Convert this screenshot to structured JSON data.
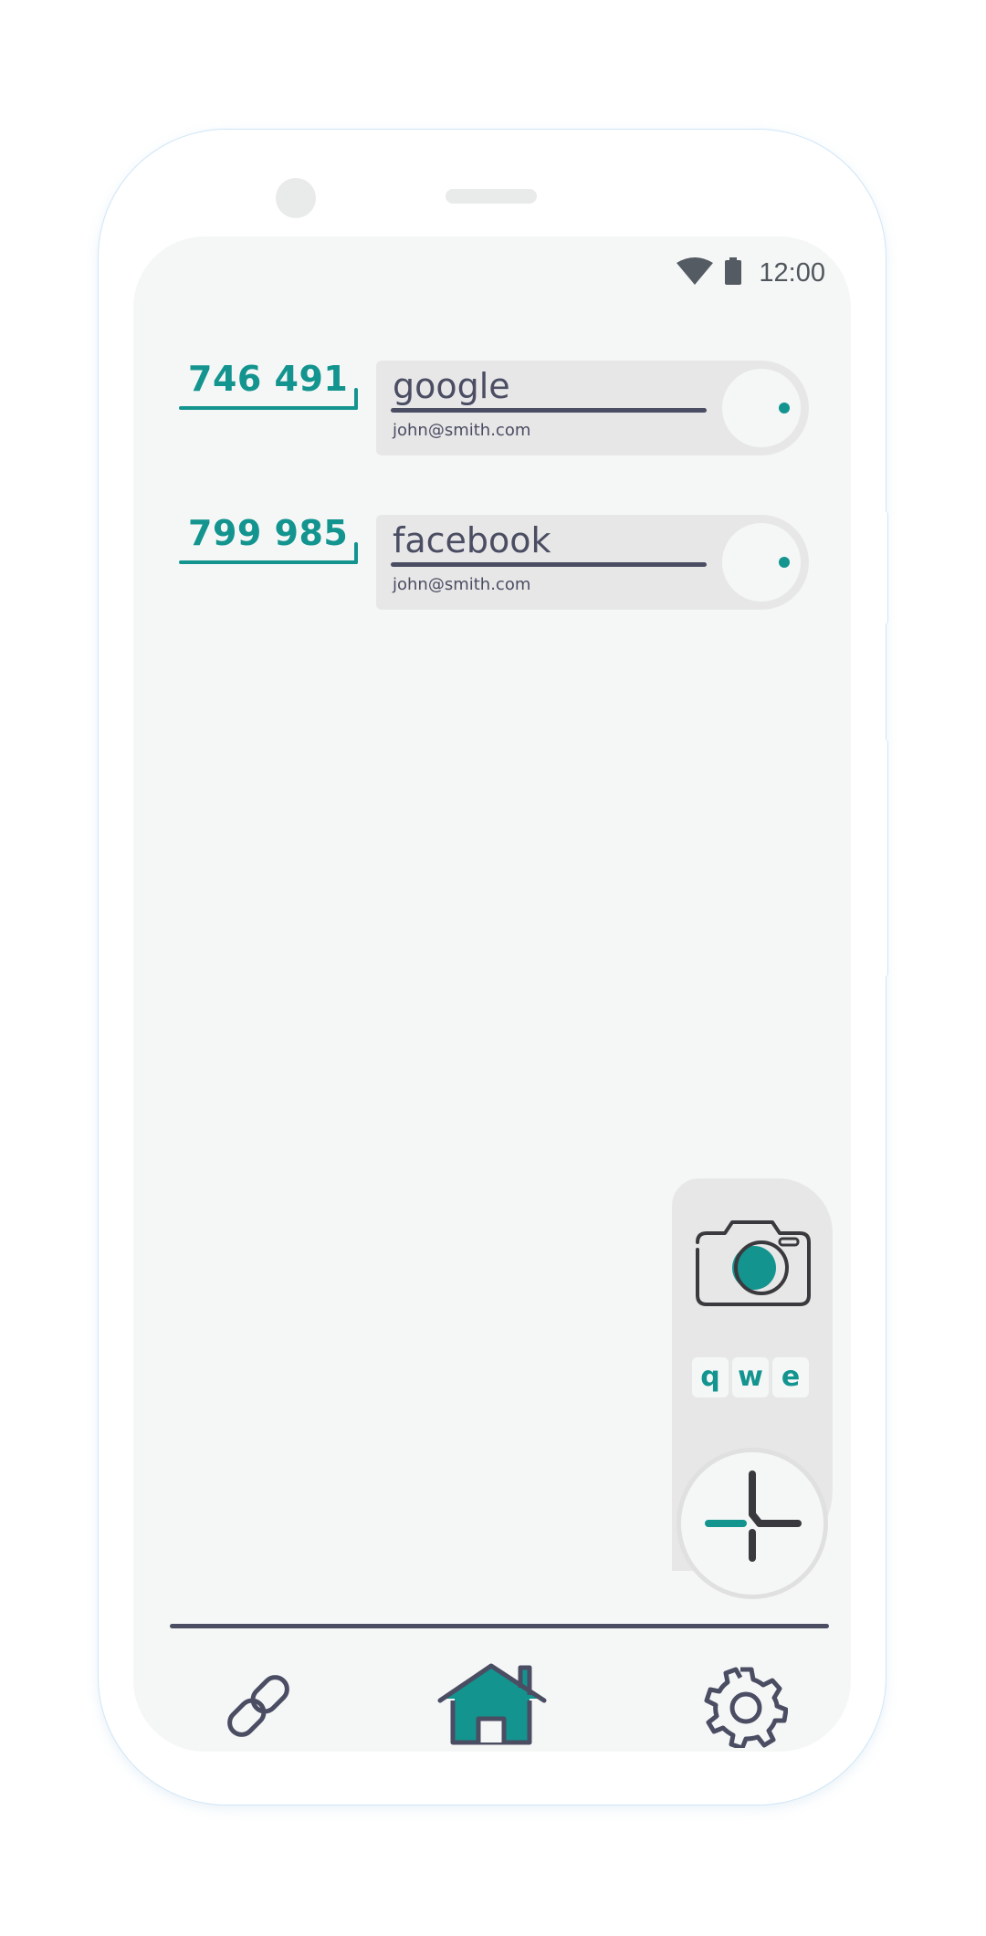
{
  "status_bar": {
    "time": "12:00",
    "wifi_icon": "wifi-icon",
    "battery_icon": "battery-icon"
  },
  "accounts": [
    {
      "code": "746 491",
      "service": "google",
      "email": "john@smith.com"
    },
    {
      "code": "799 985",
      "service": "facebook",
      "email": "john@smith.com"
    }
  ],
  "actions": {
    "camera_icon": "camera-icon",
    "keyboard_keys": [
      "q",
      "w",
      "e"
    ],
    "add_icon": "plus-icon"
  },
  "bottom_nav": {
    "items": [
      {
        "icon": "link-icon",
        "active": false
      },
      {
        "icon": "home-icon",
        "active": true
      },
      {
        "icon": "gear-icon",
        "active": false
      }
    ]
  },
  "colors": {
    "accent": "#13948f",
    "ink": "#4b4d63",
    "screen_bg": "#f5f7f7",
    "card_bg": "#e7e7e7"
  }
}
